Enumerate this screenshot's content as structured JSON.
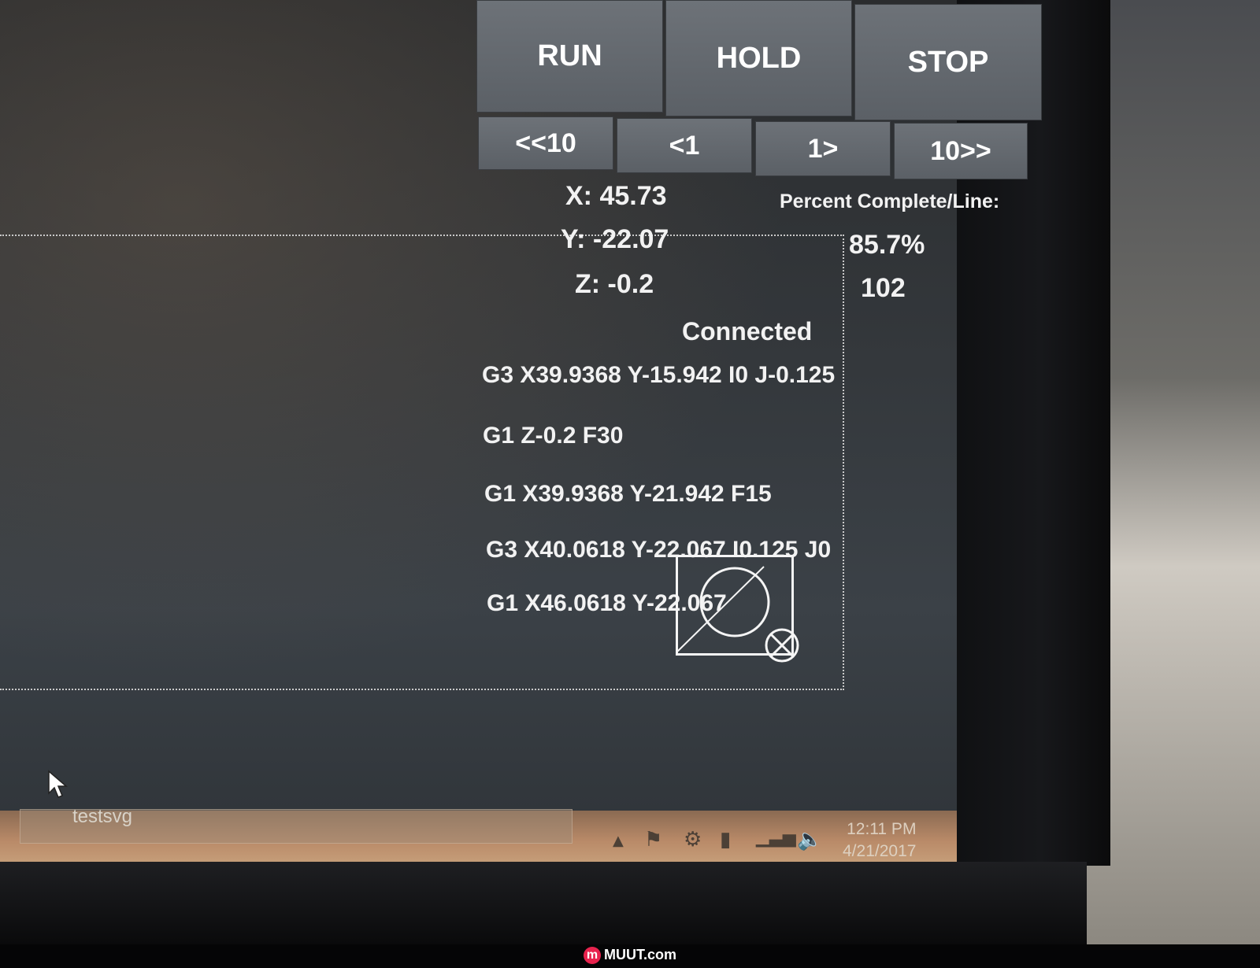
{
  "controls": {
    "run_label": "RUN",
    "hold_label": "HOLD",
    "stop_label": "STOP",
    "back10_label": "<<10",
    "back1_label": "<1",
    "fwd1_label": "1>",
    "fwd10_label": "10>>"
  },
  "position": {
    "x": "X: 45.73",
    "y": "Y: -22.07",
    "z": "Z: -0.2"
  },
  "progress": {
    "label": "Percent Complete/Line:",
    "percent": "85.7%",
    "line": "102"
  },
  "status": "Connected",
  "gcode_lines": [
    "G3 X39.9368 Y-15.942 I0 J-0.125",
    "G1 Z-0.2 F30",
    "G1 X39.9368 Y-21.942 F15",
    "G3 X40.0618 Y-22.067 I0.125 J0",
    "G1 X46.0618 Y-22.067"
  ],
  "taskbar": {
    "item": "testsvg",
    "time": "12:11 PM",
    "date": "4/21/2017"
  },
  "watermark": {
    "logo": "m",
    "text": "MUUT.com"
  },
  "icons": [
    "cursor-arrow-icon",
    "tray-up-arrow-icon",
    "flag-icon",
    "gear-icon",
    "battery-icon",
    "signal-icon",
    "speaker-icon"
  ]
}
